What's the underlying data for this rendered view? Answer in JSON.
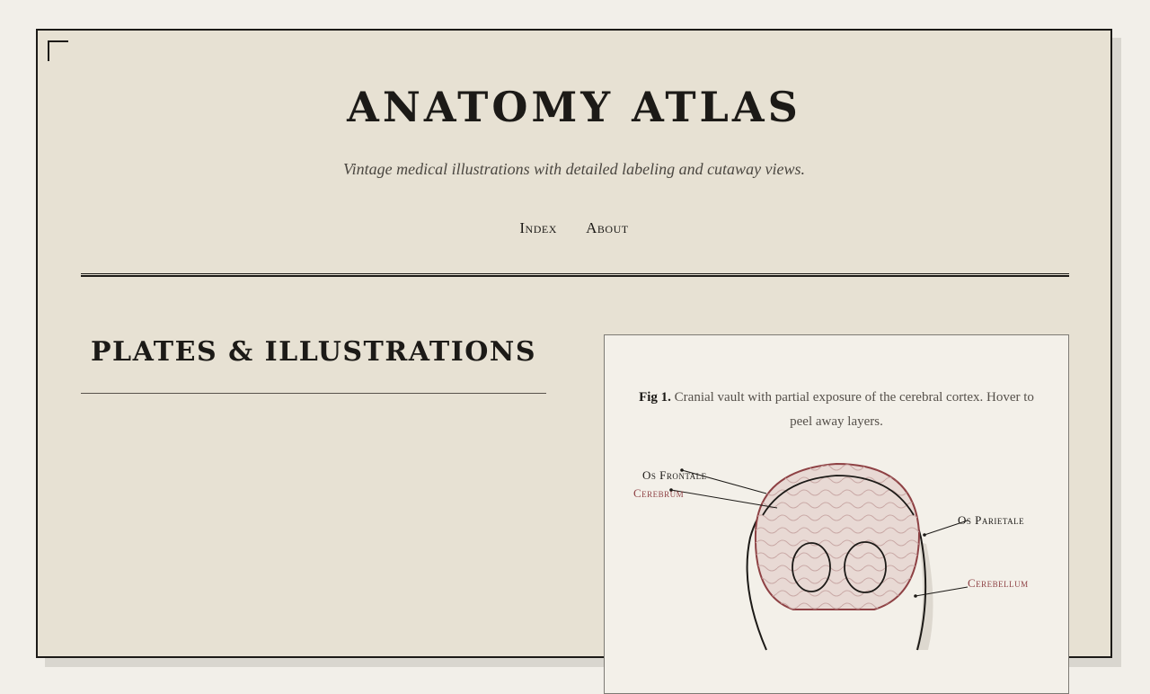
{
  "header": {
    "title": "ANATOMY ATLAS",
    "tagline": "Vintage medical illustrations with detailed labeling and cutaway views."
  },
  "nav": {
    "items": [
      {
        "label": "Index"
      },
      {
        "label": "About"
      }
    ]
  },
  "main": {
    "section_title": "PLATES & ILLUSTRATIONS"
  },
  "figure": {
    "caption_fig": "Fig 1.",
    "caption_text": "Cranial vault with partial exposure of the cerebral cortex. Hover to peel away layers.",
    "labels": {
      "os_frontale": "Os Frontale",
      "cerebrum": "Cerebrum",
      "os_parietale": "Os Parietale",
      "cerebellum": "Cerebellum"
    }
  },
  "colors": {
    "paper": "#e7e1d3",
    "ink": "#1c1a17",
    "accent": "#8e4144"
  }
}
